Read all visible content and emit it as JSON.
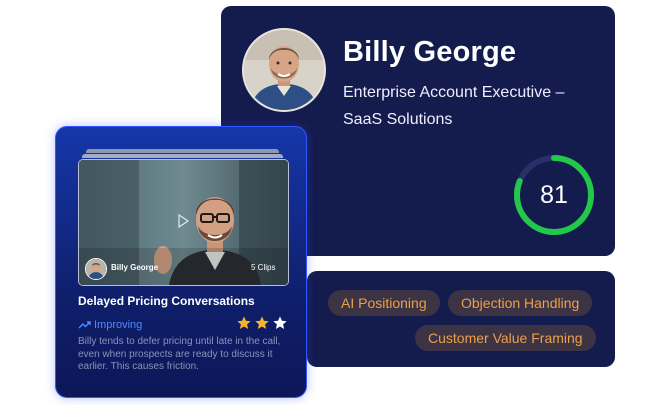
{
  "profile": {
    "name": "Billy George",
    "role": "Enterprise Account Executive – SaaS Solutions",
    "avatar": "person-photo",
    "score": 81,
    "score_fraction": 0.81
  },
  "skills": {
    "chips": [
      "AI Positioning",
      "Objection Handling",
      "Customer Value Framing"
    ]
  },
  "clip": {
    "author": "Billy George",
    "count_label": "5 Clips",
    "title": "Delayed Pricing Conversations",
    "trend_label": "Improving",
    "rating": 2,
    "rating_max": 3,
    "description": "Billy tends to defer pricing until late in the call, even when prospects are ready to discuss it earlier. This causes friction."
  },
  "colors": {
    "card_bg": "#141b4d",
    "score_ring": "#22c84a",
    "chip_text": "#ec9f4a",
    "trend": "#4c8cff",
    "star_on": "#f5b52a",
    "star_off": "#ffffff"
  }
}
